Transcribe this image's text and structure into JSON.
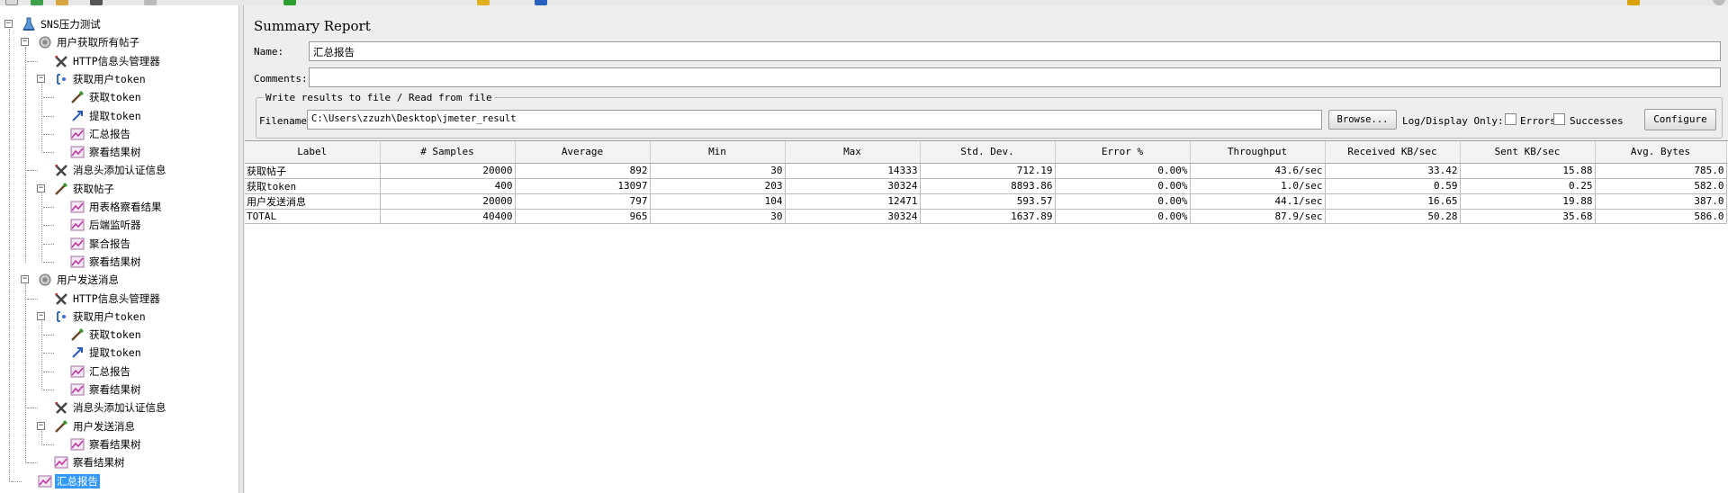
{
  "tree": {
    "items": [
      {
        "label": "SNS压力测试",
        "icon": "test-plan-icon"
      },
      {
        "label": "用户获取所有帖子",
        "icon": "thread-group-icon"
      },
      {
        "label": "HTTP信息头管理器",
        "icon": "header-manager-icon"
      },
      {
        "label": "获取用户token",
        "icon": "loop-controller-icon"
      },
      {
        "label": "获取token",
        "icon": "http-sampler-icon"
      },
      {
        "label": "提取token",
        "icon": "extractor-icon"
      },
      {
        "label": "汇总报告",
        "icon": "listener-icon"
      },
      {
        "label": "察看结果树",
        "icon": "listener-icon"
      },
      {
        "label": "消息头添加认证信息",
        "icon": "header-manager-icon"
      },
      {
        "label": "获取帖子",
        "icon": "http-sampler-icon"
      },
      {
        "label": "用表格察看结果",
        "icon": "listener-icon"
      },
      {
        "label": "后端监听器",
        "icon": "listener-icon"
      },
      {
        "label": "聚合报告",
        "icon": "listener-icon"
      },
      {
        "label": "察看结果树",
        "icon": "listener-icon"
      },
      {
        "label": "用户发送消息",
        "icon": "thread-group-icon"
      },
      {
        "label": "HTTP信息头管理器",
        "icon": "header-manager-icon"
      },
      {
        "label": "获取用户token",
        "icon": "loop-controller-icon"
      },
      {
        "label": "获取token",
        "icon": "http-sampler-icon"
      },
      {
        "label": "提取token",
        "icon": "extractor-icon"
      },
      {
        "label": "汇总报告",
        "icon": "listener-icon"
      },
      {
        "label": "察看结果树",
        "icon": "listener-icon"
      },
      {
        "label": "消息头添加认证信息",
        "icon": "header-manager-icon"
      },
      {
        "label": "用户发送消息",
        "icon": "http-sampler-icon"
      },
      {
        "label": "察看结果树",
        "icon": "listener-icon"
      },
      {
        "label": "察看结果树",
        "icon": "listener-icon"
      },
      {
        "label": "汇总报告",
        "icon": "listener-icon"
      }
    ]
  },
  "panel": {
    "title": "Summary Report",
    "name_label": "Name:",
    "name_value": "汇总报告",
    "comments_label": "Comments:",
    "comments_value": "",
    "group_title": "Write results to file / Read from file",
    "filename_label": "Filename",
    "filename_value": "C:\\Users\\zzuzh\\Desktop\\jmeter_result",
    "browse_label": "Browse...",
    "log_display_label": "Log/Display Only:",
    "errors_label": "Errors",
    "successes_label": "Successes",
    "configure_label": "Configure"
  },
  "table": {
    "headers": [
      "Label",
      "# Samples",
      "Average",
      "Min",
      "Max",
      "Std. Dev.",
      "Error %",
      "Throughput",
      "Received KB/sec",
      "Sent KB/sec",
      "Avg. Bytes"
    ],
    "rows": [
      [
        "获取帖子",
        "20000",
        "892",
        "30",
        "14333",
        "712.19",
        "0.00%",
        "43.6/sec",
        "33.42",
        "15.88",
        "785.0"
      ],
      [
        "获取token",
        "400",
        "13097",
        "203",
        "30324",
        "8893.86",
        "0.00%",
        "1.0/sec",
        "0.59",
        "0.25",
        "582.0"
      ],
      [
        "用户发送消息",
        "20000",
        "797",
        "104",
        "12471",
        "593.57",
        "0.00%",
        "44.1/sec",
        "16.65",
        "19.88",
        "387.0"
      ],
      [
        "TOTAL",
        "40400",
        "965",
        "30",
        "30324",
        "1637.89",
        "0.00%",
        "87.9/sec",
        "50.28",
        "35.68",
        "586.0"
      ]
    ]
  }
}
